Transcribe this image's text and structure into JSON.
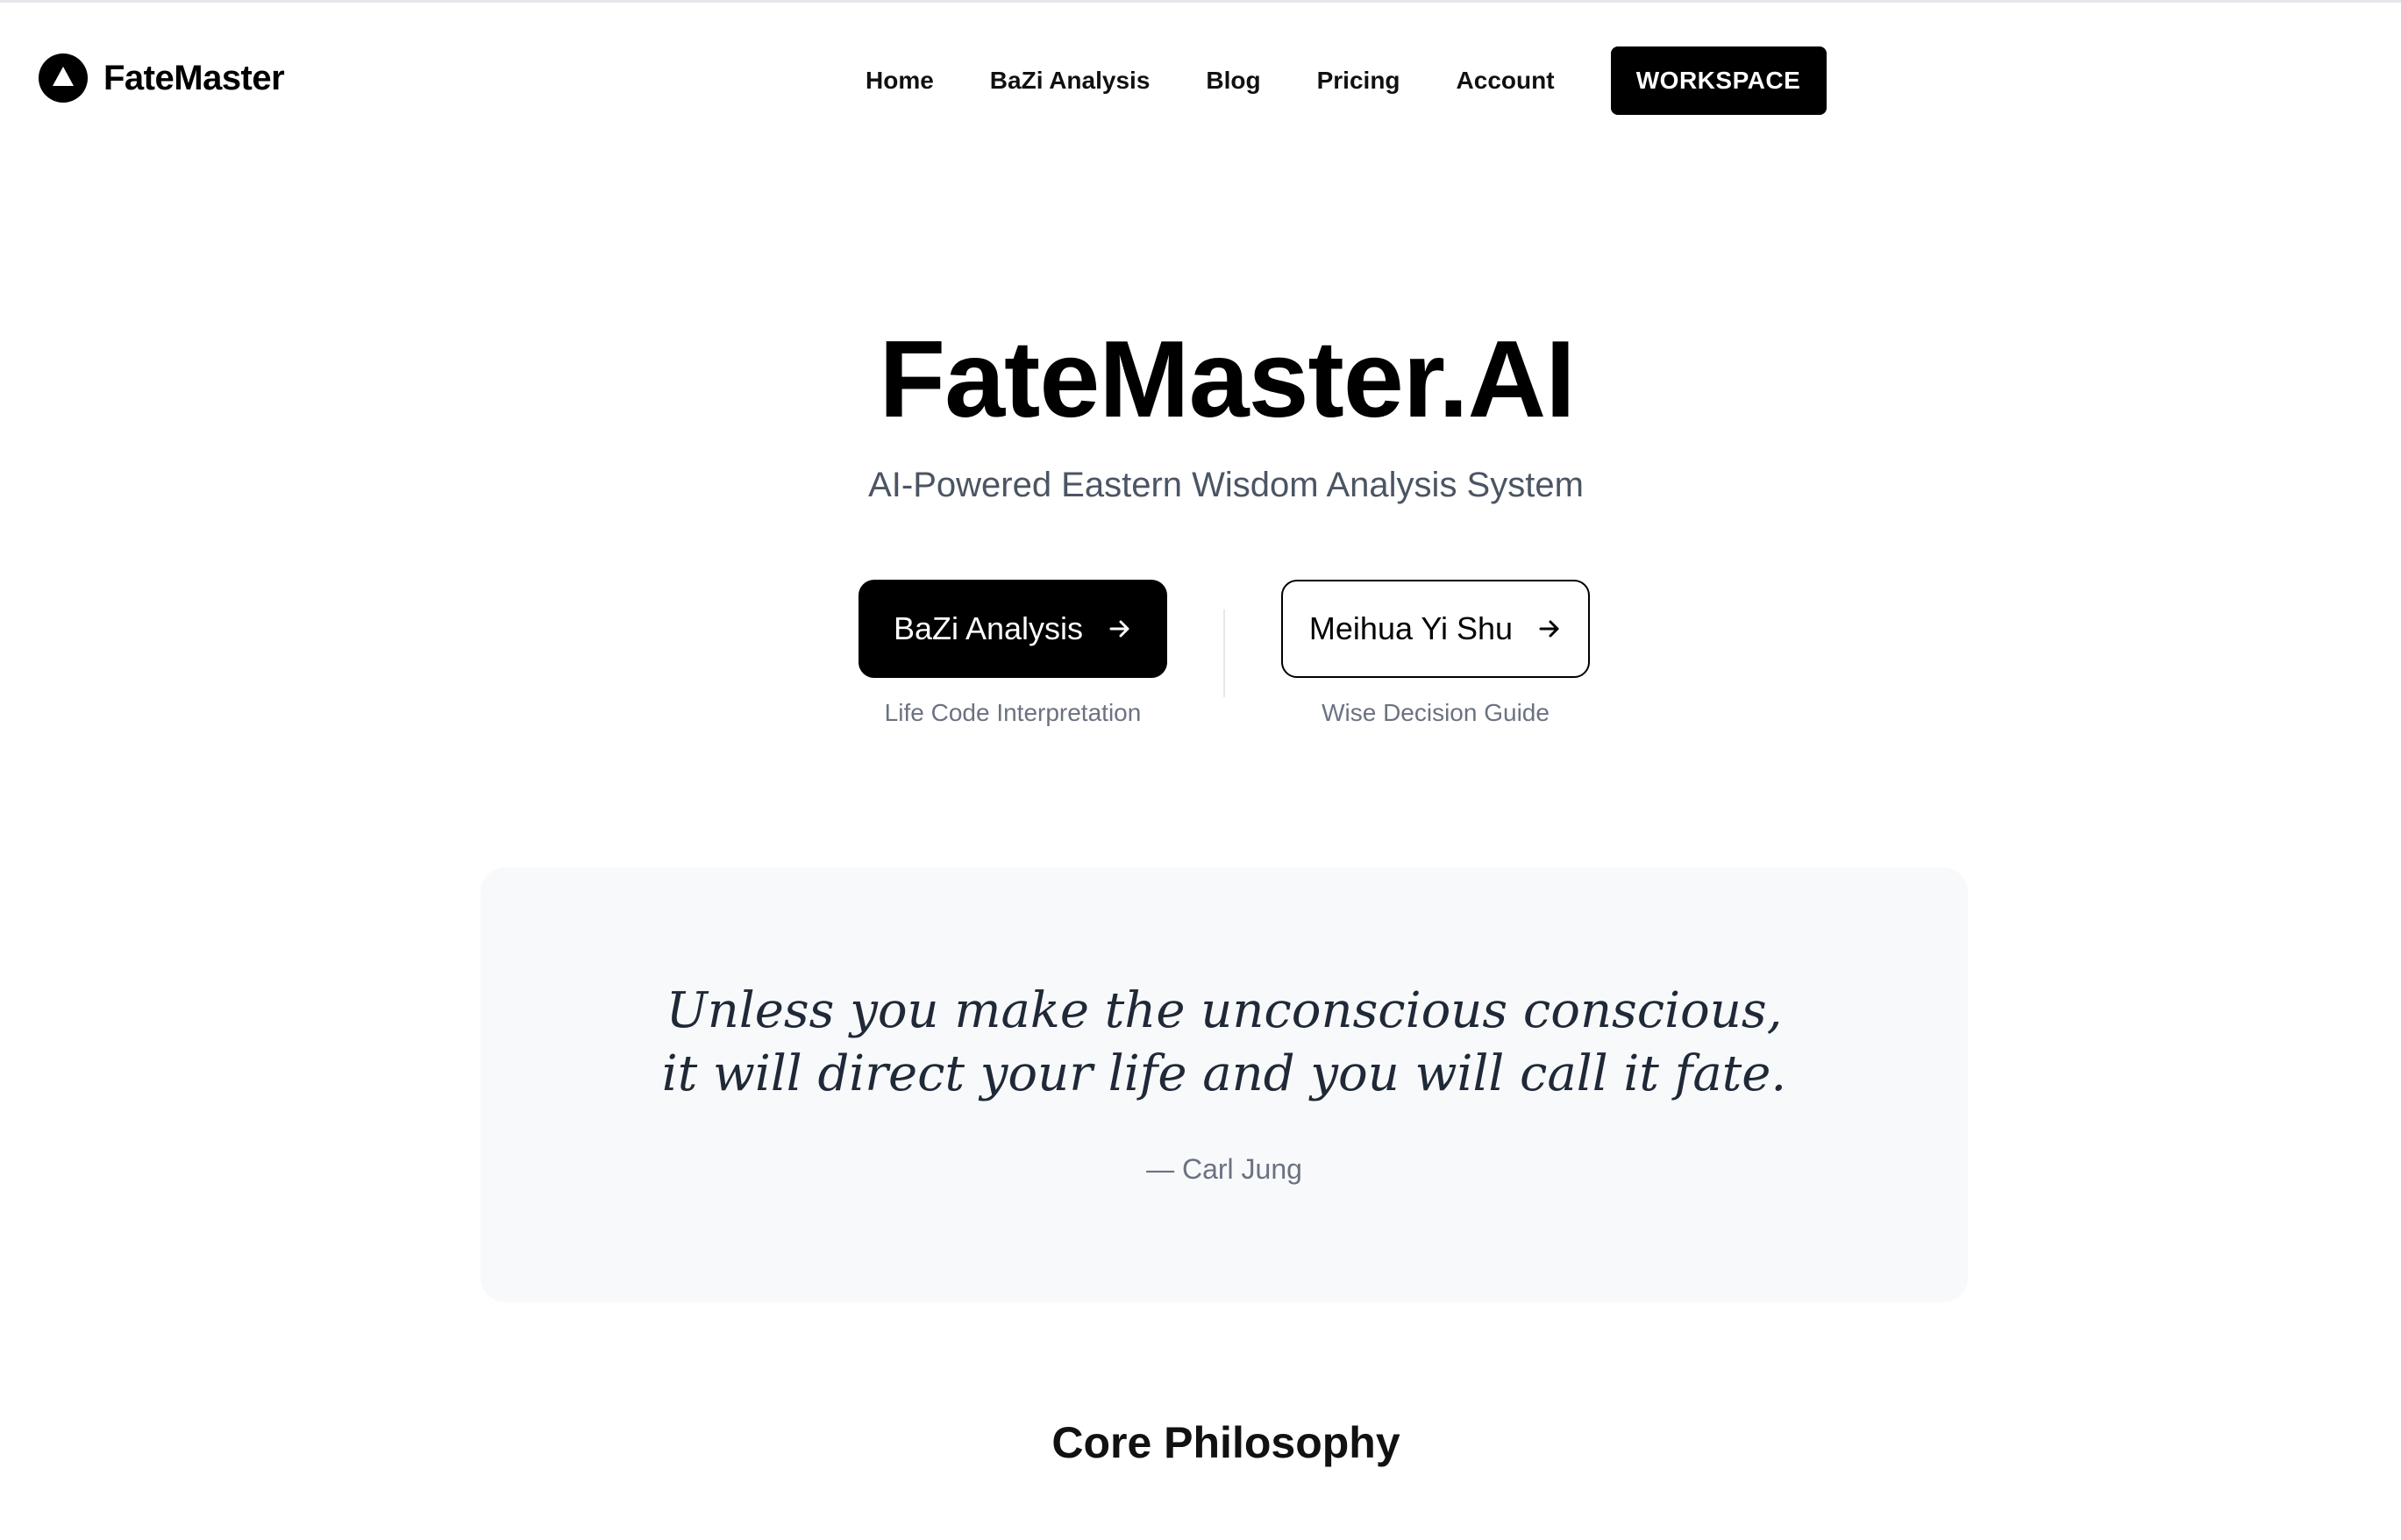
{
  "header": {
    "logo_text": "FateMaster",
    "nav": [
      {
        "label": "Home"
      },
      {
        "label": "BaZi Analysis"
      },
      {
        "label": "Blog"
      },
      {
        "label": "Pricing"
      },
      {
        "label": "Account"
      }
    ],
    "workspace_label": "WORKSPACE"
  },
  "hero": {
    "title": "FateMaster.AI",
    "subtitle": "AI-Powered Eastern Wisdom Analysis System",
    "primary_cta": {
      "label": "BaZi Analysis",
      "caption": "Life Code Interpretation"
    },
    "secondary_cta": {
      "label": "Meihua Yi Shu",
      "caption": "Wise Decision Guide"
    }
  },
  "quote": {
    "text": "Unless you make the unconscious conscious, it will direct your life and you will call it fate.",
    "author": "— Carl Jung"
  },
  "sections": {
    "core_philosophy_title": "Core Philosophy"
  },
  "colors": {
    "primary": "#000000",
    "subtitle_text": "#4b5563",
    "muted_text": "#6b7280",
    "quote_bg": "#f8f9fb",
    "quote_text": "#1f2937"
  },
  "icons": {
    "logo": "triangle-in-circle-icon",
    "cta_arrow": "arrow-right-icon"
  }
}
